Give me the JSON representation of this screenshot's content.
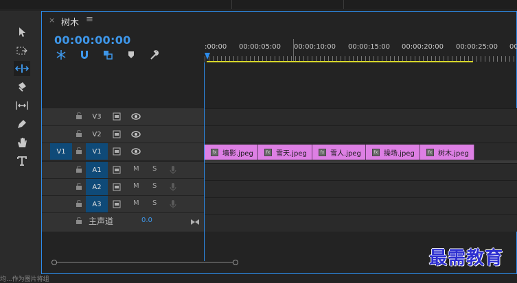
{
  "sequence": {
    "tab_title": "树木",
    "tab_close": "×",
    "tab_menu": "≡",
    "timecode": "00:00:00:00"
  },
  "ruler": {
    "labels": [
      ":00:00",
      "00:00:05:00",
      "00:00:10:00",
      "00:00:15:00",
      "00:00:20:00",
      "00:00:25:00",
      "00"
    ]
  },
  "tools": [
    {
      "name": "selection-tool",
      "icon": "arrow-icon"
    },
    {
      "name": "track-select-tool",
      "icon": "track-select-icon"
    },
    {
      "name": "ripple-edit-tool",
      "icon": "ripple-edit-icon",
      "active": true
    },
    {
      "name": "razor-tool",
      "icon": "razor-icon"
    },
    {
      "name": "slip-tool",
      "icon": "slip-icon"
    },
    {
      "name": "pen-tool",
      "icon": "pen-icon"
    },
    {
      "name": "hand-tool",
      "icon": "hand-icon"
    },
    {
      "name": "type-tool",
      "icon": "type-icon"
    }
  ],
  "tracks": {
    "video": [
      {
        "label": "V3"
      },
      {
        "label": "V2"
      },
      {
        "label": "V1",
        "source": "V1"
      }
    ],
    "audio": [
      {
        "label": "A1",
        "mute": "M",
        "solo": "S"
      },
      {
        "label": "A2",
        "mute": "M",
        "solo": "S"
      },
      {
        "label": "A3",
        "mute": "M",
        "solo": "S"
      }
    ],
    "master": {
      "label": "主声道",
      "value": "0.0"
    }
  },
  "clips": [
    {
      "name": "墙影.jpeg",
      "fx": "fx"
    },
    {
      "name": "雪天.jpeg",
      "fx": "fx"
    },
    {
      "name": "雪人.jpeg",
      "fx": "fx"
    },
    {
      "name": "操场.jpeg",
      "fx": "fx"
    },
    {
      "name": "树木.jpeg",
      "fx": "fx"
    }
  ],
  "colors": {
    "accent": "#2d8ceb",
    "clip": "#dd7fe4",
    "work_area": "#d7d72a",
    "track_selected": "#0f4a78"
  },
  "watermark": "最需教育",
  "bottom_text": "均...作为图片将组"
}
